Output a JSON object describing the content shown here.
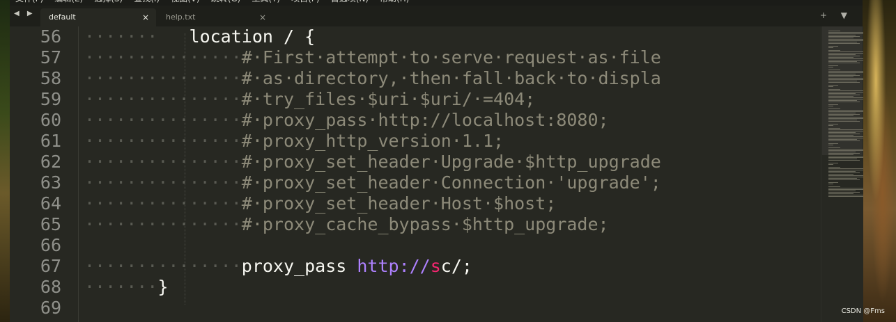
{
  "menu": [
    "文件(F)",
    "编辑(E)",
    "选择(S)",
    "查找(I)",
    "视图(V)",
    "跳转(G)",
    "工具(T)",
    "项目(P)",
    "首选项(N)",
    "帮助(H)"
  ],
  "tabs": [
    {
      "label": "default",
      "active": true,
      "close": "×"
    },
    {
      "label": "help.txt",
      "active": false,
      "close": "×"
    }
  ],
  "nav_arrows": "◀ ▶",
  "tab_tools": "+ ▼",
  "code": {
    "line_numbers": [
      "56",
      "57",
      "58",
      "59",
      "60",
      "61",
      "62",
      "63",
      "64",
      "65",
      "66",
      "67",
      "68",
      "69"
    ],
    "lines": [
      {
        "ws": "·······",
        "gap": "   ",
        "text": "location / {",
        "kind": "plain"
      },
      {
        "ws": "···············",
        "gap": "",
        "text": "#·First·attempt·to·serve·request·as·file",
        "kind": "comment"
      },
      {
        "ws": "···············",
        "gap": "",
        "text": "#·as·directory,·then·fall·back·to·displa",
        "kind": "comment"
      },
      {
        "ws": "···············",
        "gap": "",
        "text": "#·try_files·$uri·$uri/·=404;",
        "kind": "comment"
      },
      {
        "ws": "···············",
        "gap": "",
        "text": "#·proxy_pass·http://localhost:8080;",
        "kind": "comment"
      },
      {
        "ws": "···············",
        "gap": "",
        "text": "#·proxy_http_version·1.1;",
        "kind": "comment"
      },
      {
        "ws": "···············",
        "gap": "",
        "text": "#·proxy_set_header·Upgrade·$http_upgrade",
        "kind": "comment"
      },
      {
        "ws": "···············",
        "gap": "",
        "text": "#·proxy_set_header·Connection·'upgrade';",
        "kind": "comment"
      },
      {
        "ws": "···············",
        "gap": "",
        "text": "#·proxy_set_header·Host·$host;",
        "kind": "comment"
      },
      {
        "ws": "···············",
        "gap": "",
        "text": "#·proxy_cache_bypass·$http_upgrade;",
        "kind": "comment"
      },
      {
        "ws": "",
        "gap": "",
        "text": "",
        "kind": "plain"
      },
      {
        "ws": "···············",
        "gap": "",
        "text": "",
        "kind": "proxy"
      },
      {
        "ws": "·······",
        "gap": "",
        "text": "}",
        "kind": "plain"
      },
      {
        "ws": "",
        "gap": "",
        "text": "",
        "kind": "plain"
      }
    ],
    "proxy_line": {
      "directive": "proxy_pass ",
      "scheme": "http://",
      "host_hl": "s",
      "host_rest": "c/;"
    }
  },
  "watermark": "CSDN @Fms",
  "colors": {
    "background": "#272822",
    "comment": "#8d8a79",
    "url": "#ae81ff",
    "keyword": "#f92672",
    "text": "#f8f8f2"
  }
}
